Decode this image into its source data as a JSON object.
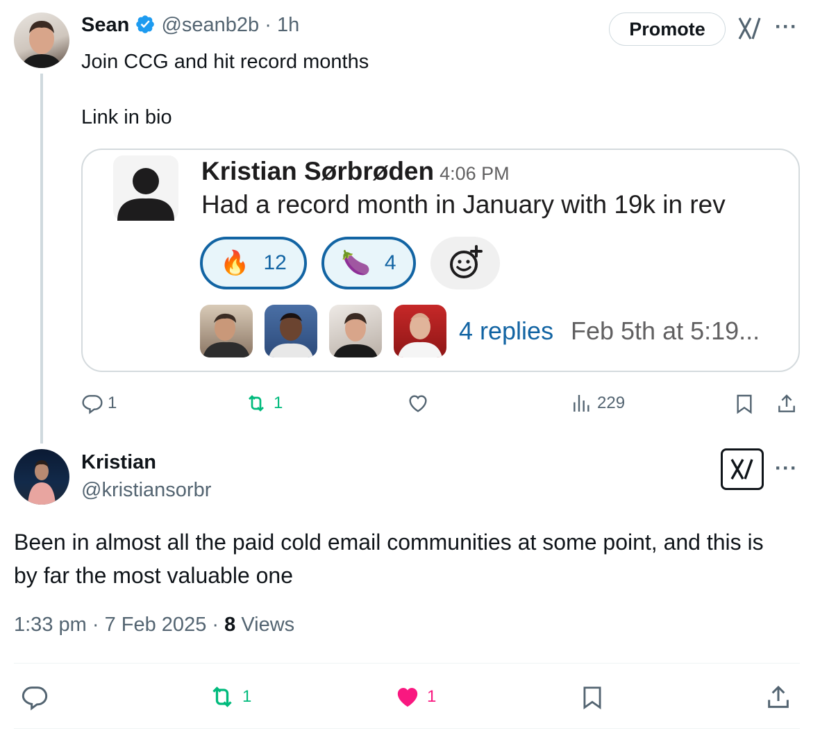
{
  "tweet1": {
    "author_name": "Sean",
    "handle": "@seanb2b",
    "separator": "·",
    "time": "1h",
    "promote_label": "Promote",
    "line1": "Join CCG and hit record months",
    "line2": "Link in bio",
    "embed": {
      "author": "Kristian Sørbrøden",
      "time": "4:06 PM",
      "message": "Had a record month in January with 19k in rev",
      "reactions": [
        {
          "emoji": "🔥",
          "count": "12"
        },
        {
          "emoji": "🍆",
          "count": "4"
        }
      ],
      "replies_label": "4 replies",
      "reply_time": "Feb 5th at 5:19..."
    },
    "stats": {
      "replies": "1",
      "reposts": "1",
      "views": "229"
    }
  },
  "tweet2": {
    "author_name": "Kristian",
    "handle": "@kristiansorbr",
    "text": "Been in almost all the paid cold email communities at some point, and this is by far the most valuable one",
    "time": "1:33 pm",
    "date": "7 Feb 2025",
    "views_count": "8",
    "views_label": "Views",
    "separator": "·",
    "stats": {
      "reposts": "1",
      "likes": "1"
    }
  },
  "colors": {
    "text": "#0f1419",
    "muted": "#536471",
    "verified": "#1d9bf0",
    "repost": "#00ba7c",
    "like": "#f91880",
    "slack_blue": "#1264a3"
  }
}
